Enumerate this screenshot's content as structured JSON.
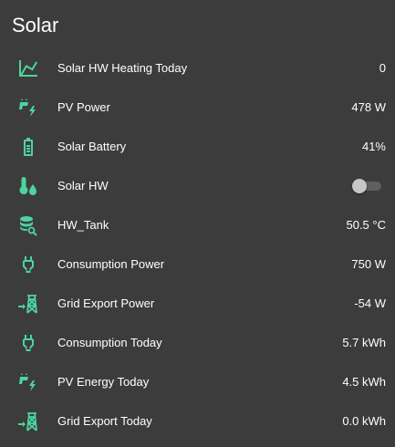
{
  "card": {
    "title": "Solar"
  },
  "colors": {
    "icon": "#4ed3a0",
    "background": "#3c3c3c",
    "text": "#ffffff",
    "toggle_track": "#5f5f5f",
    "toggle_thumb": "#c6c6c6"
  },
  "entities": [
    {
      "icon": "chart-line-icon",
      "name": "Solar HW Heating Today",
      "value": "0"
    },
    {
      "icon": "solar-power-icon",
      "name": "PV Power",
      "value": "478 W"
    },
    {
      "icon": "battery-icon",
      "name": "Solar Battery",
      "value": "41%"
    },
    {
      "icon": "thermometer-water-icon",
      "name": "Solar HW",
      "toggle": "off"
    },
    {
      "icon": "database-search-icon",
      "name": "HW_Tank",
      "value": "50.5 °C"
    },
    {
      "icon": "power-plug-icon",
      "name": "Consumption Power",
      "value": "750 W"
    },
    {
      "icon": "transmission-tower-export-icon",
      "name": "Grid Export Power",
      "value": "-54 W"
    },
    {
      "icon": "power-plug-icon",
      "name": "Consumption Today",
      "value": "5.7 kWh"
    },
    {
      "icon": "solar-power-icon",
      "name": "PV Energy Today",
      "value": "4.5 kWh"
    },
    {
      "icon": "transmission-tower-export-icon",
      "name": "Grid Export Today",
      "value": "0.0 kWh"
    }
  ]
}
